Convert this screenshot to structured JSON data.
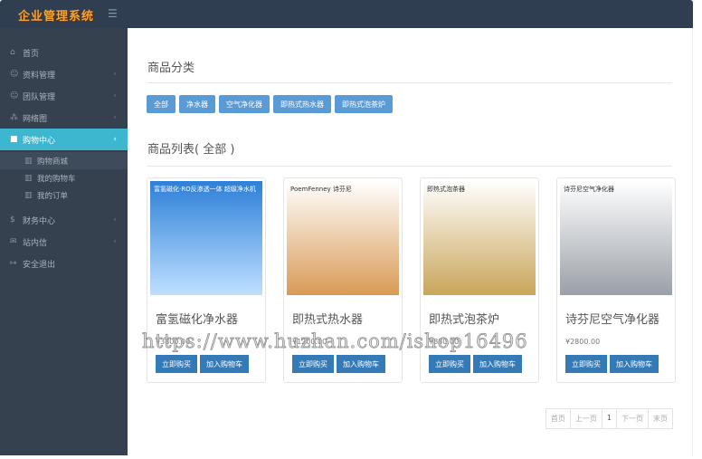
{
  "header": {
    "logo": "企业管理系统",
    "menu_icon": "hamburger-icon"
  },
  "sidebar": {
    "items": [
      {
        "label": "首页",
        "icon": "home-icon"
      },
      {
        "label": "资料管理",
        "icon": "user-icon"
      },
      {
        "label": "团队管理",
        "icon": "team-icon"
      },
      {
        "label": "网络图",
        "icon": "sitemap-icon"
      },
      {
        "label": "购物中心",
        "icon": "truck-icon"
      },
      {
        "label": "财务中心",
        "icon": "dollar-icon"
      },
      {
        "label": "站内信",
        "icon": "mail-icon"
      },
      {
        "label": "安全退出",
        "icon": "logout-icon"
      }
    ],
    "sub": [
      {
        "label": "购物商城"
      },
      {
        "label": "我的购物车"
      },
      {
        "label": "我的订单"
      }
    ]
  },
  "main": {
    "category_title": "商品分类",
    "categories": [
      "全部",
      "净水器",
      "空气净化器",
      "即热式热水器",
      "即热式泡茶炉"
    ],
    "list_title": "商品列表( 全部 )",
    "products": [
      {
        "name": "富氢磁化净水器",
        "price": "¥3800.00",
        "img_text": "富氢磁化·RO反渗透一体  超级净水机",
        "color": "#3d8fe0"
      },
      {
        "name": "即热式热水器",
        "price": "¥1200.00",
        "img_text": "PoemFenney 诗芬尼",
        "color": "#d99a55"
      },
      {
        "name": "即热式泡茶炉",
        "price": "¥880.00",
        "img_text": "即热式泡茶器",
        "color": "#c9a55a"
      },
      {
        "name": "诗芬尼空气净化器",
        "price": "¥2800.00",
        "img_text": "诗芬尼空气净化器",
        "color": "#9aa0a8"
      }
    ],
    "buy_label": "立即购买",
    "cart_label": "加入购物车",
    "pager": [
      "首页",
      "上一页",
      "1",
      "下一页",
      "末页"
    ]
  },
  "watermark": "https://www.huzhan.com/ishop16496"
}
